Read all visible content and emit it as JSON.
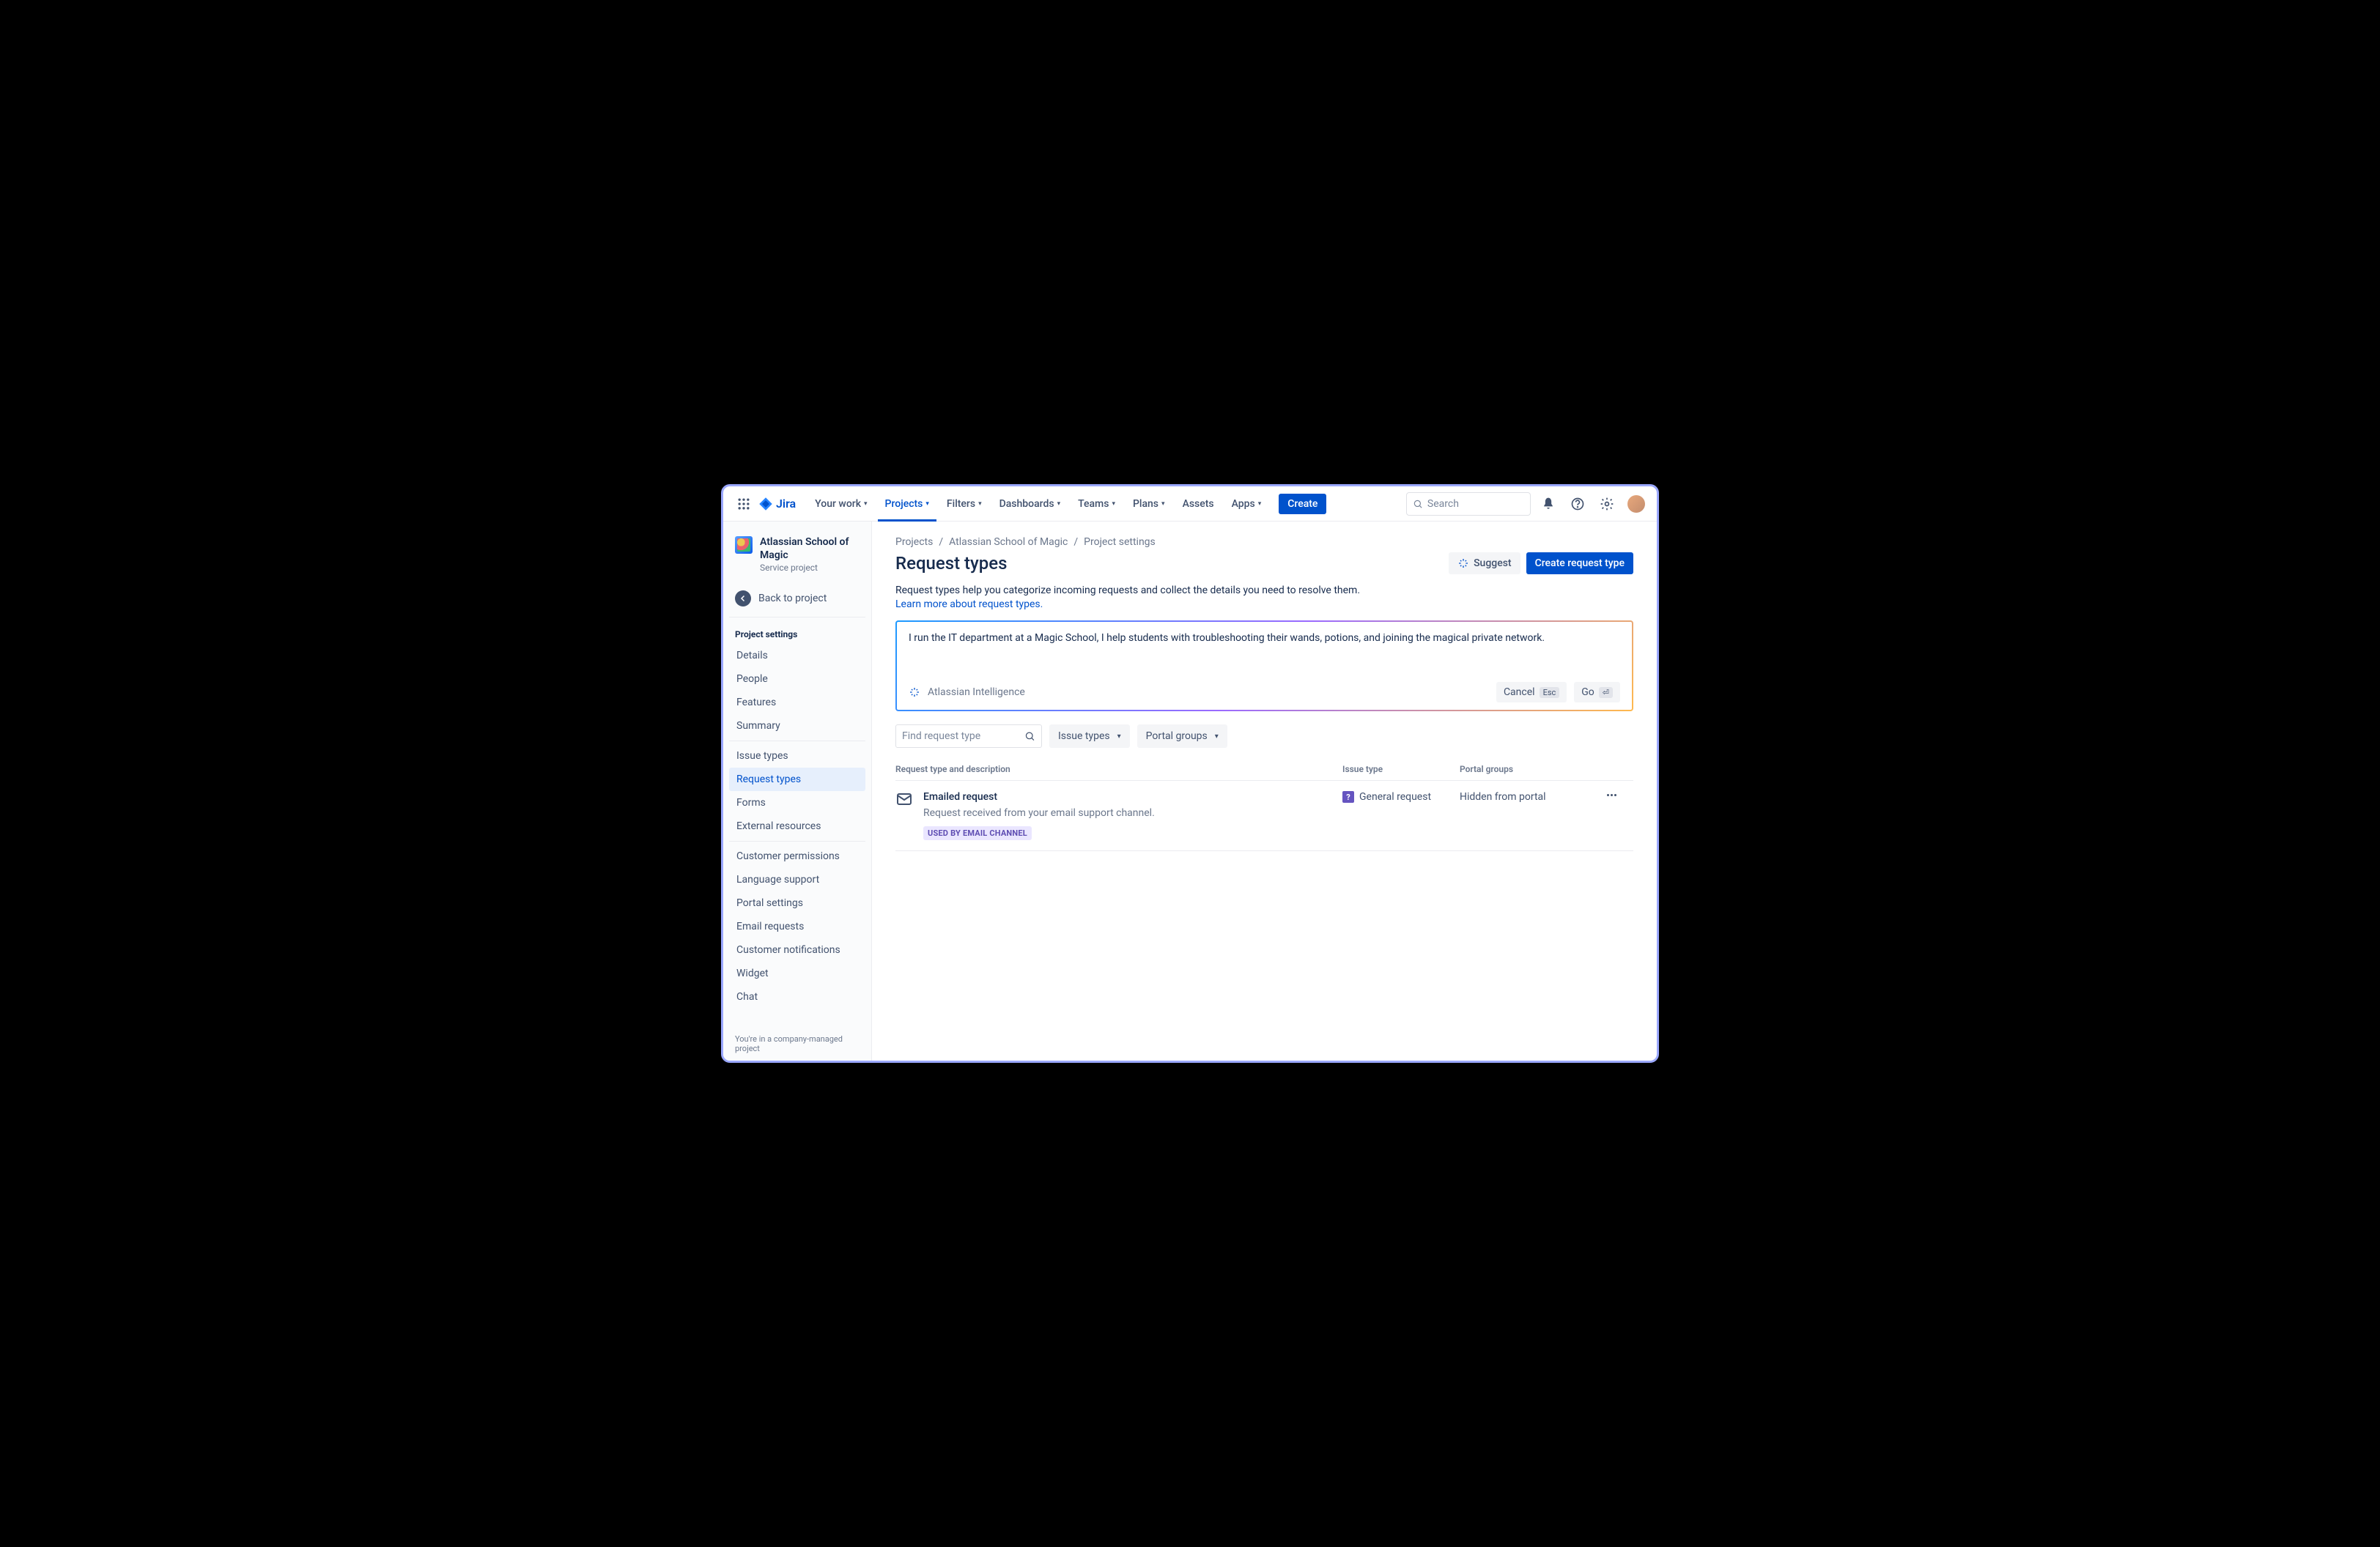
{
  "brand": "Jira",
  "nav": {
    "your_work": "Your work",
    "projects": "Projects",
    "filters": "Filters",
    "dashboards": "Dashboards",
    "teams": "Teams",
    "plans": "Plans",
    "assets": "Assets",
    "apps": "Apps",
    "create": "Create"
  },
  "search_placeholder": "Search",
  "sidebar": {
    "project_title": "Atlassian School of Magic",
    "project_sub": "Service project",
    "back": "Back to project",
    "section": "Project settings",
    "items": [
      {
        "label": "Details"
      },
      {
        "label": "People"
      },
      {
        "label": "Features"
      },
      {
        "label": "Summary"
      }
    ],
    "items2": [
      {
        "label": "Issue types"
      },
      {
        "label": "Request types"
      },
      {
        "label": "Forms"
      },
      {
        "label": "External resources"
      }
    ],
    "items3": [
      {
        "label": "Customer permissions"
      },
      {
        "label": "Language support"
      },
      {
        "label": "Portal settings"
      },
      {
        "label": "Email requests"
      },
      {
        "label": "Customer notifications"
      },
      {
        "label": "Widget"
      },
      {
        "label": "Chat"
      }
    ],
    "footer": "You're in a company-managed project"
  },
  "breadcrumb": {
    "a": "Projects",
    "b": "Atlassian School of Magic",
    "c": "Project settings"
  },
  "page": {
    "title": "Request types",
    "suggest": "Suggest",
    "create": "Create request type",
    "desc": "Request types help you categorize incoming requests and collect the details you need to resolve them.",
    "learn": "Learn more about request types."
  },
  "ai": {
    "text": "I run the IT department at a Magic School, I help students with troubleshooting their wands, potions, and joining the magical private network.",
    "label": "Atlassian Intelligence",
    "cancel": "Cancel",
    "cancel_kbd": "Esc",
    "go": "Go",
    "go_kbd": "⏎"
  },
  "filters": {
    "find_placeholder": "Find request type",
    "issue_types": "Issue types",
    "portal_groups": "Portal groups"
  },
  "table": {
    "h1": "Request type and description",
    "h2": "Issue type",
    "h3": "Portal groups",
    "row": {
      "title": "Emailed request",
      "desc": "Request received from your email support channel.",
      "badge": "USED BY EMAIL CHANNEL",
      "issue_type": "General request",
      "portal": "Hidden from portal"
    }
  }
}
